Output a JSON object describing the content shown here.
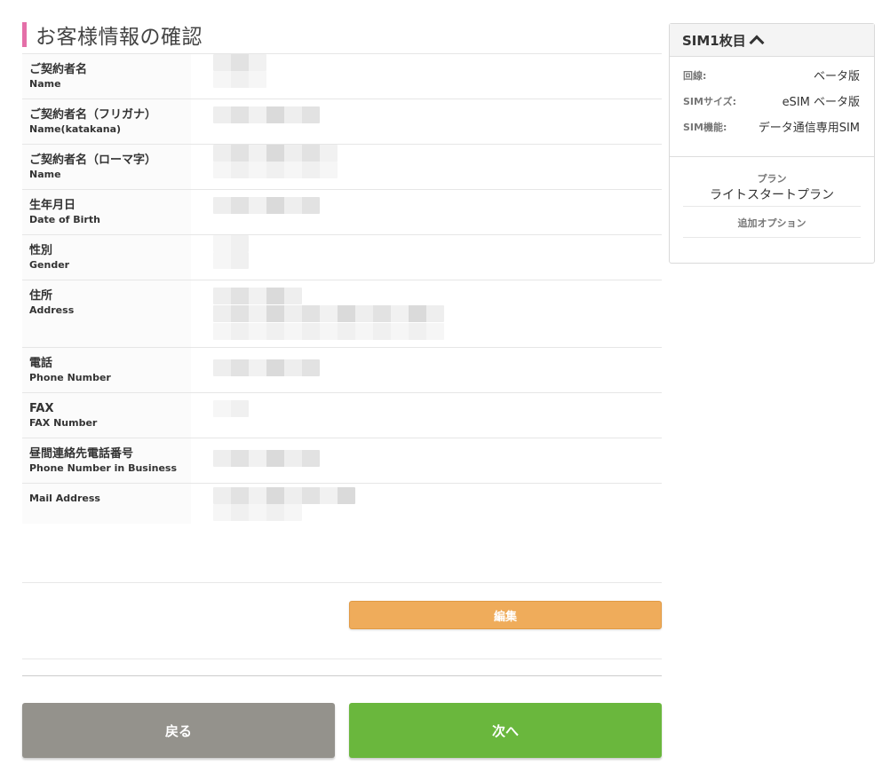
{
  "title": "お客様情報の確認",
  "rows": [
    {
      "ja": "ご契約者名",
      "en": "Name"
    },
    {
      "ja": "ご契約者名（フリガナ）",
      "en": "Name(katakana)"
    },
    {
      "ja": "ご契約者名（ローマ字）",
      "en": "Name"
    },
    {
      "ja": "生年月日",
      "en": "Date of Birth"
    },
    {
      "ja": "性別",
      "en": "Gender"
    },
    {
      "ja": "住所",
      "en": "Address"
    },
    {
      "ja": "電話",
      "en": "Phone Number"
    },
    {
      "ja": "FAX",
      "en": "FAX Number"
    },
    {
      "ja": "昼間連絡先電話番号",
      "en": "Phone Number in Business"
    },
    {
      "ja": "",
      "en": "Mail Address"
    }
  ],
  "buttons": {
    "edit": "編集",
    "back": "戻る",
    "next": "次へ"
  },
  "sidebar": {
    "header": "SIM1枚目",
    "specs": [
      {
        "key": "回線:",
        "value": "ベータ版"
      },
      {
        "key": "SIMサイズ:",
        "value": "eSIM ベータ版"
      },
      {
        "key": "SIM機能:",
        "value": "データ通信専用SIM"
      }
    ],
    "plan_label": "プラン",
    "plan_name": "ライトスタートプラン",
    "option_label": "追加オプション"
  },
  "colors": {
    "accent": "#e46fa8",
    "edit": "#efac5b",
    "back": "#94928c",
    "next": "#6ab73d"
  }
}
